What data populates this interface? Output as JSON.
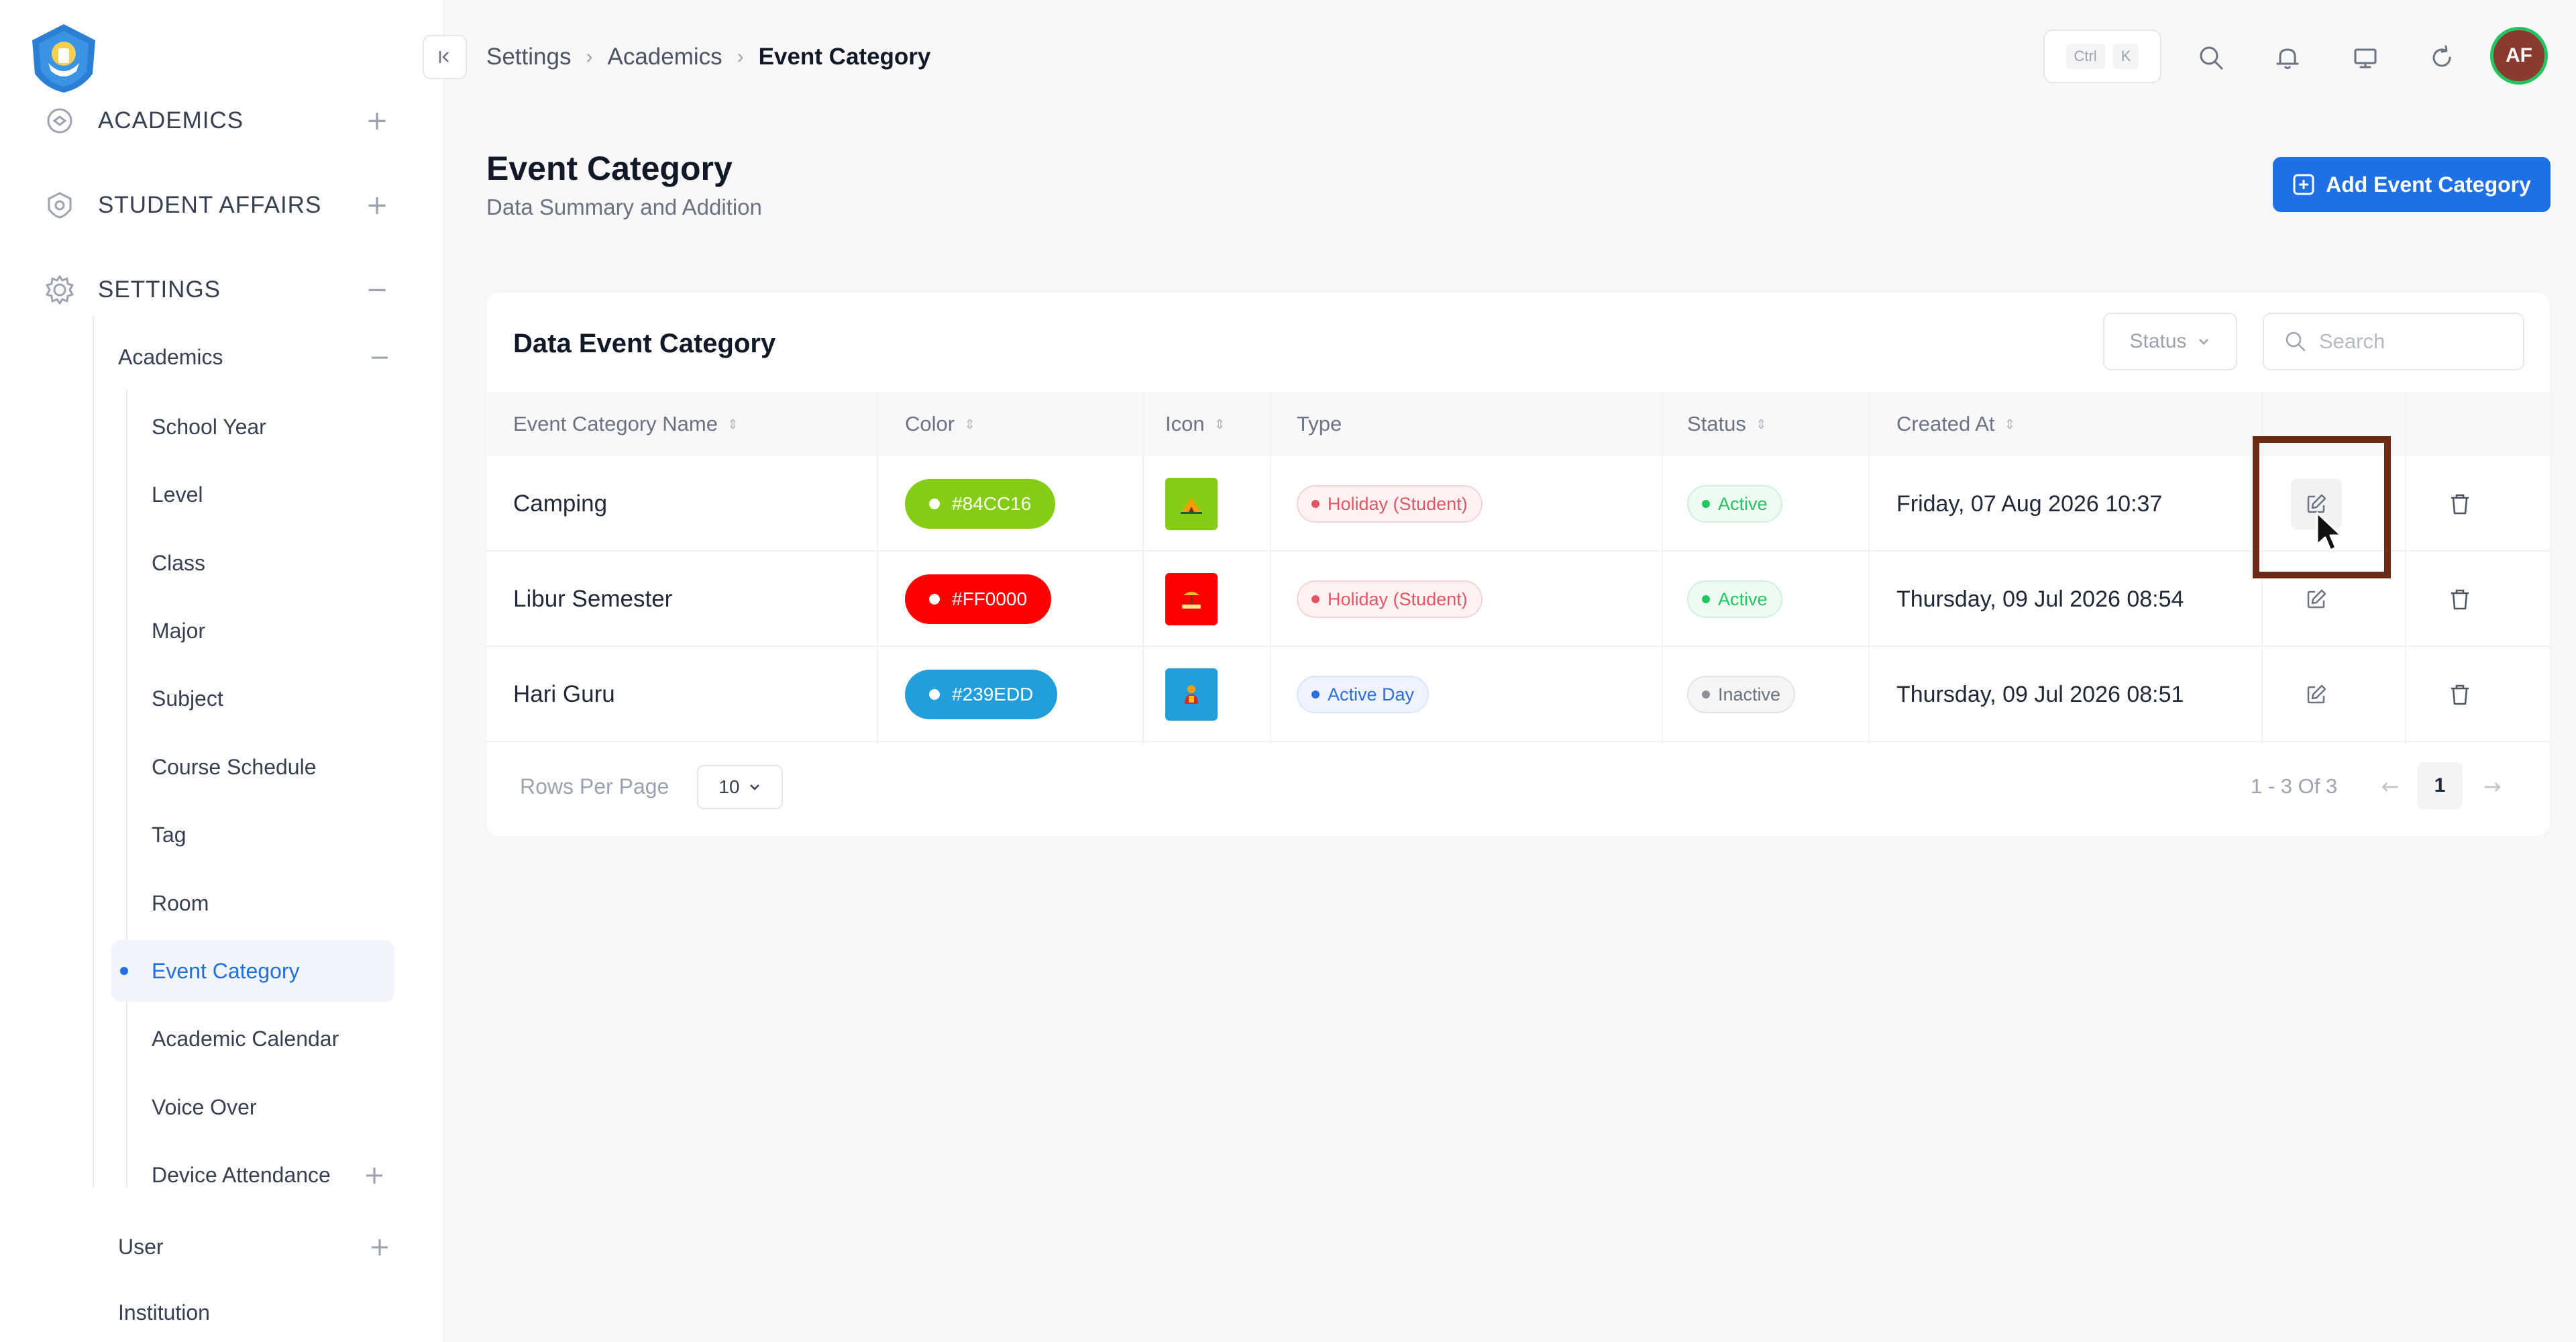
{
  "sidebar": {
    "sections": [
      {
        "label": "ACADEMICS",
        "toggle": "+"
      },
      {
        "label": "STUDENT AFFAIRS",
        "toggle": "+"
      },
      {
        "label": "SETTINGS",
        "toggle": "−"
      }
    ],
    "groups": {
      "academics": {
        "label": "Academics",
        "toggle": "−"
      },
      "user": {
        "label": "User",
        "toggle": "+"
      },
      "institution": {
        "label": "Institution"
      }
    },
    "items": [
      {
        "label": "School Year"
      },
      {
        "label": "Level"
      },
      {
        "label": "Class"
      },
      {
        "label": "Major"
      },
      {
        "label": "Subject"
      },
      {
        "label": "Course Schedule"
      },
      {
        "label": "Tag"
      },
      {
        "label": "Room"
      },
      {
        "label": "Event Category"
      },
      {
        "label": "Academic Calendar"
      },
      {
        "label": "Voice Over"
      },
      {
        "label": "Device Attendance",
        "toggle": "+"
      }
    ],
    "active_item": "Event Category"
  },
  "topbar": {
    "breadcrumb": [
      "Settings",
      "Academics",
      "Event Category"
    ],
    "shortcut": [
      "Ctrl",
      "K"
    ],
    "avatar_initials": "AF",
    "icons": [
      "search-icon",
      "bell-icon",
      "monitor-icon",
      "refresh-icon"
    ]
  },
  "page": {
    "title": "Event Category",
    "subtitle": "Data Summary and Addition",
    "add_button": "Add Event Category"
  },
  "card": {
    "title": "Data Event Category",
    "status_filter": "Status",
    "search_placeholder": "Search",
    "columns": [
      "Event Category Name",
      "Color",
      "Icon",
      "Type",
      "Status",
      "Created At"
    ],
    "rows": [
      {
        "name": "Camping",
        "color": "#84CC16",
        "icon": "camping-icon",
        "type": "Holiday (Student)",
        "status": "Active",
        "created_at": "Friday, 07 Aug 2026 10:37"
      },
      {
        "name": "Libur Semester",
        "color": "#FF0000",
        "icon": "holiday-icon",
        "type": "Holiday (Student)",
        "status": "Active",
        "created_at": "Thursday, 09 Jul 2026 08:54"
      },
      {
        "name": "Hari Guru",
        "color": "#239EDD",
        "icon": "teacher-icon",
        "type": "Active Day",
        "status": "Inactive",
        "created_at": "Thursday, 09 Jul 2026 08:51"
      }
    ],
    "footer": {
      "rows_per_page_label": "Rows Per Page",
      "rows_per_page": "10",
      "range": "1 - 3 Of 3",
      "page": "1",
      "prev": "←",
      "next": "→"
    }
  },
  "colors": {
    "primary": "#1f6fe5",
    "highlight_box": "#6b2c16",
    "avatar_bg": "#8b3a2f",
    "avatar_ring": "#22c55e"
  }
}
